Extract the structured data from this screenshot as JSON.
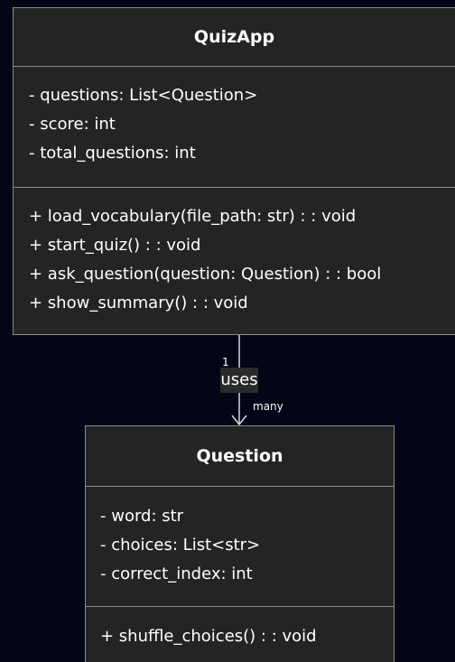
{
  "classes": {
    "quizapp": {
      "name": "QuizApp",
      "attributes": [
        "- questions: List<Question>",
        "- score: int",
        "- total_questions: int"
      ],
      "methods": [
        "+ load_vocabulary(file_path: str) : : void",
        "+ start_quiz() : : void",
        "+ ask_question(question: Question) : : bool",
        "+ show_summary() : : void"
      ]
    },
    "question": {
      "name": "Question",
      "attributes": [
        "- word: str",
        "- choices: List<str>",
        "- correct_index: int"
      ],
      "methods": [
        "+ shuffle_choices() : : void"
      ]
    }
  },
  "association": {
    "label": "uses",
    "source_multiplicity": "1",
    "target_multiplicity": "many"
  },
  "colors": {
    "background": "#020617",
    "box_fill": "#242424",
    "box_border": "#8c8c8c",
    "text": "#ffffff"
  }
}
